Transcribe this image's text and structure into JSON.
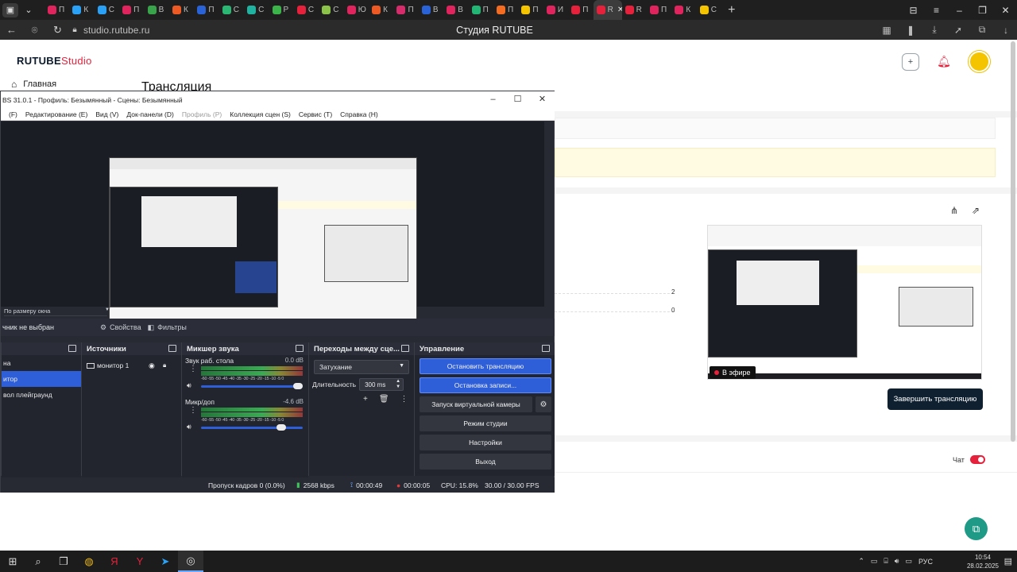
{
  "browser": {
    "tabs": [
      {
        "label": "П",
        "color": "#e0245e"
      },
      {
        "label": "К",
        "color": "#2aa1f5"
      },
      {
        "label": "С",
        "color": "#2aa1f5"
      },
      {
        "label": "П",
        "color": "#e0245e"
      },
      {
        "label": "В",
        "color": "#38a34a"
      },
      {
        "label": "К",
        "color": "#ee5a24"
      },
      {
        "label": "П",
        "color": "#2a62d8"
      },
      {
        "label": "С",
        "color": "#2bb673"
      },
      {
        "label": "С",
        "color": "#20b3a1"
      },
      {
        "label": "Р",
        "color": "#3bb54a"
      },
      {
        "label": "С",
        "color": "#e6213b"
      },
      {
        "label": "С",
        "color": "#8bc34a"
      },
      {
        "label": "Ю",
        "color": "#e0245e"
      },
      {
        "label": "К",
        "color": "#ee5a24"
      },
      {
        "label": "П",
        "color": "#d62c6b"
      },
      {
        "label": "В",
        "color": "#2a62d8"
      },
      {
        "label": "В",
        "color": "#e0245e"
      },
      {
        "label": "П",
        "color": "#22b573"
      },
      {
        "label": "П",
        "color": "#f36c21"
      },
      {
        "label": "П",
        "color": "#f5c400"
      },
      {
        "label": "И",
        "color": "#e0245e"
      },
      {
        "label": "П",
        "color": "#e6213b"
      }
    ],
    "active_tab_label": "R",
    "tabs_after": [
      {
        "label": "R",
        "color": "#e6213b"
      },
      {
        "label": "П",
        "color": "#e0245e"
      },
      {
        "label": "К",
        "color": "#e0245e"
      },
      {
        "label": "С",
        "color": "#f5c400"
      }
    ],
    "url": "studio.rutube.ru",
    "page_title": "Студия RUTUBE"
  },
  "site": {
    "logo_main": "RUTUBE",
    "logo_studio": "Studio",
    "nav_home": "Главная",
    "heading": "Трансляция",
    "chart_numbers": [
      "2",
      "0"
    ],
    "live_badge": "В эфире",
    "end_stream_label": "Завершить трансляцию",
    "chat_label": "Чат",
    "colors": {
      "brand_red": "#e6213b",
      "end_button": "#0f2130",
      "fab": "#1e9a86"
    }
  },
  "obs": {
    "title": "BS 31.0.1 - Профиль: Безымянный - Сцены: Безымянный",
    "menu": [
      {
        "label": "(F)",
        "disabled": false
      },
      {
        "label": "Редактирование (E)",
        "disabled": false
      },
      {
        "label": "Вид (V)",
        "disabled": false
      },
      {
        "label": "Док-панели (D)",
        "disabled": false
      },
      {
        "label": "Профиль (P)",
        "disabled": true
      },
      {
        "label": "Коллекция сцен (S)",
        "disabled": false
      },
      {
        "label": "Сервис (T)",
        "disabled": false
      },
      {
        "label": "Справка (H)",
        "disabled": false
      }
    ],
    "scale_mode": "По размеру окна",
    "source_none": "чник не выбран",
    "properties_btn": "Свойства",
    "filters_btn": "Фильтры",
    "scenes": {
      "title": "",
      "items": [
        {
          "label": "на",
          "selected": false
        },
        {
          "label": "итор",
          "selected": true
        },
        {
          "label": "вол плейграунд",
          "selected": false
        }
      ]
    },
    "sources": {
      "title": "Источники",
      "items": [
        {
          "label": "монитор 1"
        }
      ]
    },
    "mixer": {
      "title": "Микшер звука",
      "scale": "-60 -55 -50 -45 -40 -35 -30 -25 -20 -15 -10 -5 0",
      "channels": [
        {
          "name": "Звук раб. стола",
          "db": "0.0 dB",
          "volume": 1.0
        },
        {
          "name": "Микр/доп",
          "db": "-4.6 dB",
          "volume": 0.82
        }
      ]
    },
    "transitions": {
      "title": "Переходы между сце...",
      "selected": "Затухание",
      "duration_label": "Длительность",
      "duration_value": "300 ms"
    },
    "controls": {
      "title": "Управление",
      "stop_stream": "Остановить трансляцию",
      "stop_record": "Остановка записи...",
      "virtual_cam": "Запуск виртуальной камеры",
      "studio_mode": "Режим студии",
      "settings": "Настройки",
      "exit": "Выход"
    },
    "status": {
      "dropped": "Пропуск кадров 0 (0.0%)",
      "bitrate": "2568 kbps",
      "stream_time": "00:00:49",
      "record_time": "00:00:05",
      "cpu": "CPU: 15.8%",
      "fps": "30.00 / 30.00 FPS"
    }
  },
  "taskbar": {
    "lang": "РУС",
    "time": "10:54",
    "date": "28.02.2025"
  }
}
